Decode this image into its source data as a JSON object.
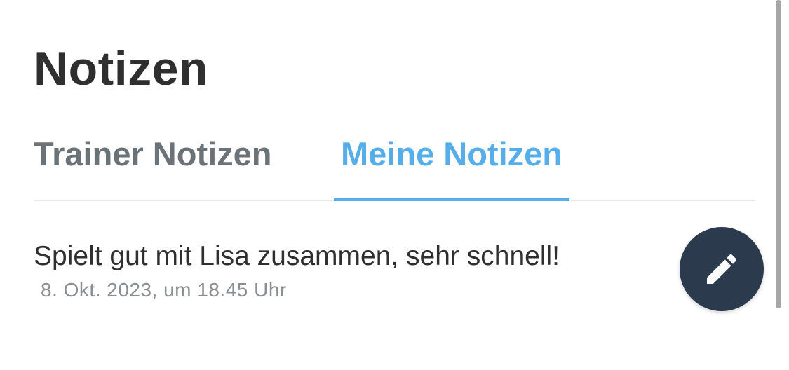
{
  "header": {
    "title": "Notizen"
  },
  "tabs": [
    {
      "label": "Trainer Notizen",
      "active": false
    },
    {
      "label": "Meine Notizen",
      "active": true
    }
  ],
  "notes": [
    {
      "text": "Spielt gut mit Lisa zusammen, sehr schnell!",
      "date": "8. Okt. 2023, um 18.45 Uhr"
    }
  ],
  "fab": {
    "icon": "pencil-icon"
  },
  "colors": {
    "accent": "#55aeea",
    "inactive_tab": "#6b7378",
    "fab_background": "#2b3a4d",
    "text": "#2f2f2f",
    "muted": "#8b8e91"
  }
}
